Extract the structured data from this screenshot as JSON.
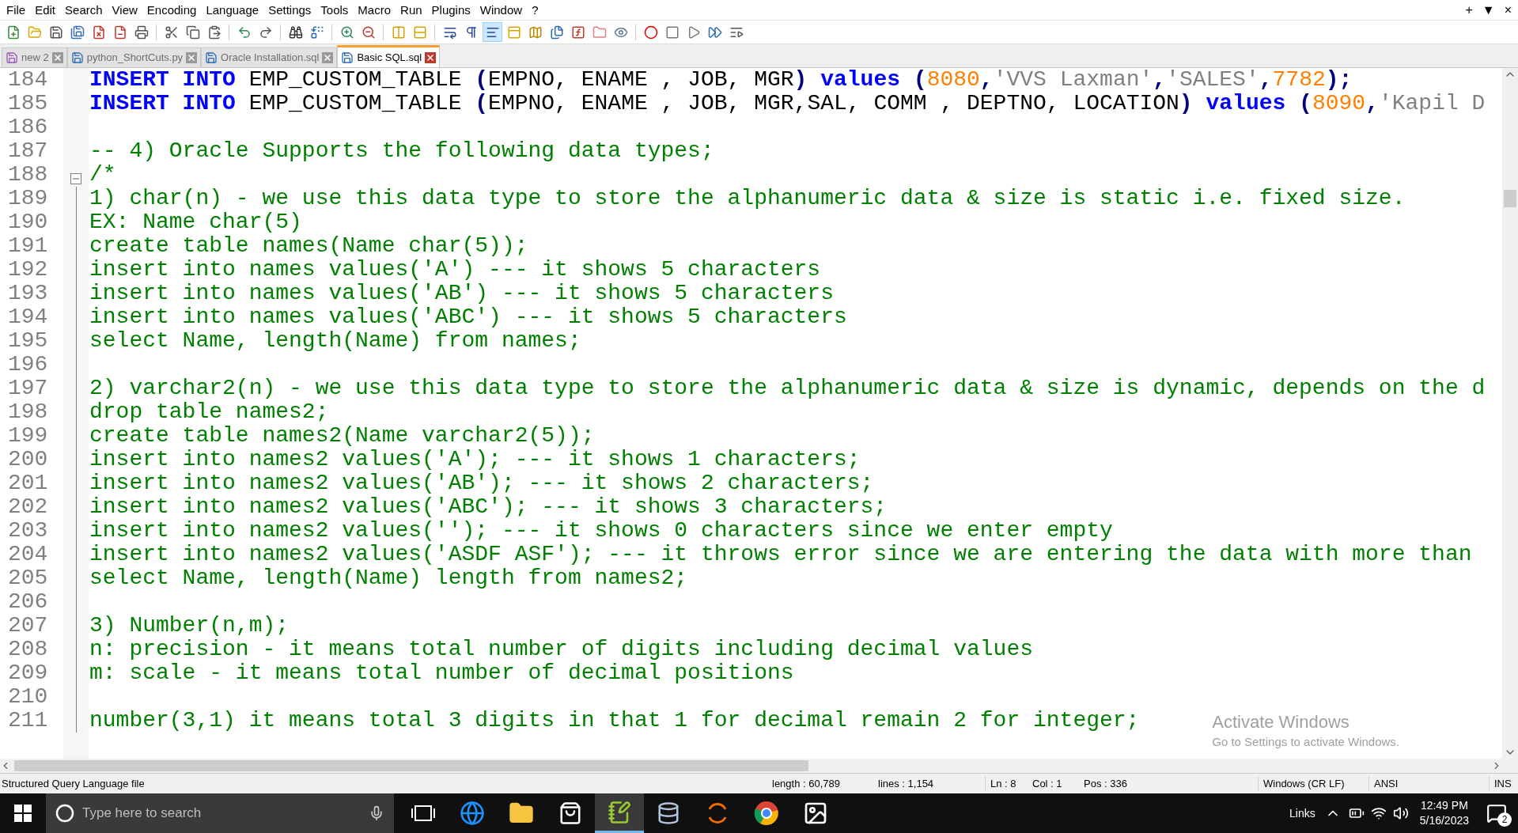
{
  "menu": [
    "File",
    "Edit",
    "Search",
    "View",
    "Encoding",
    "Language",
    "Settings",
    "Tools",
    "Macro",
    "Run",
    "Plugins",
    "Window",
    "?"
  ],
  "window_controls": [
    "+",
    "▼",
    "×"
  ],
  "toolbar_buttons": [
    {
      "pressed": false
    },
    {
      "pressed": false
    },
    {
      "pressed": false
    },
    {
      "pressed": false
    },
    {
      "pressed": false
    },
    {
      "pressed": false
    },
    {
      "pressed": false
    },
    {
      "pressed": false
    },
    {
      "pressed": false
    },
    {
      "pressed": false
    },
    {
      "pressed": false
    },
    {
      "pressed": false
    },
    {
      "pressed": false
    },
    {
      "pressed": false
    },
    {
      "pressed": false
    },
    {
      "pressed": false
    },
    {
      "pressed": false
    },
    {
      "pressed": false
    },
    {
      "pressed": false
    },
    {
      "pressed": false
    },
    {
      "pressed": true
    },
    {
      "pressed": false
    },
    {
      "pressed": false
    },
    {
      "pressed": false
    },
    {
      "pressed": false
    },
    {
      "pressed": false
    },
    {
      "pressed": false
    },
    {
      "pressed": false
    },
    {
      "pressed": false
    },
    {
      "pressed": false
    },
    {
      "pressed": false
    },
    {
      "pressed": false
    }
  ],
  "tabs": [
    {
      "label": "new 2",
      "selected": false,
      "modified": true
    },
    {
      "label": "python_ShortCuts.py",
      "selected": false,
      "modified": false
    },
    {
      "label": "Oracle Installation.sql",
      "selected": false,
      "modified": false
    },
    {
      "label": "Basic SQL.sql",
      "selected": true,
      "modified": false
    }
  ],
  "editor": {
    "lines": [
      {
        "number": "184",
        "segments": [
          {
            "kind": "keyword",
            "text": "INSERT INTO"
          },
          {
            "kind": "plain",
            "text": " EMP_CUSTOM_TABLE "
          },
          {
            "kind": "operator",
            "text": "("
          },
          {
            "kind": "plain",
            "text": "EMPNO, ENAME , JOB, MGR"
          },
          {
            "kind": "operator",
            "text": ") "
          },
          {
            "kind": "keyword",
            "text": "values "
          },
          {
            "kind": "operator",
            "text": "("
          },
          {
            "kind": "number",
            "text": "8080"
          },
          {
            "kind": "operator",
            "text": ","
          },
          {
            "kind": "string",
            "text": "'VVS Laxman'"
          },
          {
            "kind": "operator",
            "text": ","
          },
          {
            "kind": "string",
            "text": "'SALES'"
          },
          {
            "kind": "operator",
            "text": ","
          },
          {
            "kind": "number",
            "text": "7782"
          },
          {
            "kind": "operator",
            "text": ");"
          }
        ]
      },
      {
        "number": "185",
        "segments": [
          {
            "kind": "keyword",
            "text": "INSERT INTO"
          },
          {
            "kind": "plain",
            "text": " EMP_CUSTOM_TABLE "
          },
          {
            "kind": "operator",
            "text": "("
          },
          {
            "kind": "plain",
            "text": "EMPNO, ENAME , JOB, MGR,SAL, COMM , DEPTNO, LOCATION"
          },
          {
            "kind": "operator",
            "text": ") "
          },
          {
            "kind": "keyword",
            "text": "values "
          },
          {
            "kind": "operator",
            "text": "("
          },
          {
            "kind": "number",
            "text": "8090"
          },
          {
            "kind": "operator",
            "text": ","
          },
          {
            "kind": "string",
            "text": "'Kapil D"
          }
        ]
      },
      {
        "number": "186"
      },
      {
        "number": "187",
        "segments": [
          {
            "kind": "comment",
            "text": "-- 4) Oracle Supports the following data types;"
          }
        ]
      },
      {
        "number": "188",
        "fold_marker": true,
        "segments": [
          {
            "kind": "comment",
            "text": "/*"
          }
        ]
      },
      {
        "number": "189",
        "fold_line": true,
        "segments": [
          {
            "kind": "comment",
            "text": "1) char(n) - we use this data type to store the alphanumeric data & size is static i.e. fixed size."
          }
        ]
      },
      {
        "number": "190",
        "fold_line": true,
        "segments": [
          {
            "kind": "comment",
            "text": "EX: Name char(5)"
          }
        ]
      },
      {
        "number": "191",
        "fold_line": true,
        "segments": [
          {
            "kind": "comment",
            "text": "create table names(Name char(5));"
          }
        ]
      },
      {
        "number": "192",
        "fold_line": true,
        "segments": [
          {
            "kind": "comment",
            "text": "insert into names values('A') --- it shows 5 characters"
          }
        ]
      },
      {
        "number": "193",
        "fold_line": true,
        "segments": [
          {
            "kind": "comment",
            "text": "insert into names values('AB') --- it shows 5 characters"
          }
        ]
      },
      {
        "number": "194",
        "fold_line": true,
        "segments": [
          {
            "kind": "comment",
            "text": "insert into names values('ABC') --- it shows 5 characters"
          }
        ]
      },
      {
        "number": "195",
        "fold_line": true,
        "segments": [
          {
            "kind": "comment",
            "text": "select Name, length(Name) from names;"
          }
        ]
      },
      {
        "number": "196",
        "fold_line": true
      },
      {
        "number": "197",
        "fold_line": true,
        "segments": [
          {
            "kind": "comment",
            "text": "2) varchar2(n) - we use this data type to store the alphanumeric data & size is dynamic, depends on the d"
          }
        ]
      },
      {
        "number": "198",
        "fold_line": true,
        "segments": [
          {
            "kind": "comment",
            "text": "drop table names2;"
          }
        ]
      },
      {
        "number": "199",
        "fold_line": true,
        "segments": [
          {
            "kind": "comment",
            "text": "create table names2(Name varchar2(5));"
          }
        ]
      },
      {
        "number": "200",
        "fold_line": true,
        "segments": [
          {
            "kind": "comment",
            "text": "insert into names2 values('A'); --- it shows 1 characters;"
          }
        ]
      },
      {
        "number": "201",
        "fold_line": true,
        "segments": [
          {
            "kind": "comment",
            "text": "insert into names2 values('AB'); --- it shows 2 characters;"
          }
        ]
      },
      {
        "number": "202",
        "fold_line": true,
        "segments": [
          {
            "kind": "comment",
            "text": "insert into names2 values('ABC'); --- it shows 3 characters;"
          }
        ]
      },
      {
        "number": "203",
        "fold_line": true,
        "segments": [
          {
            "kind": "comment",
            "text": "insert into names2 values(''); --- it shows 0 characters since we enter empty"
          }
        ]
      },
      {
        "number": "204",
        "fold_line": true,
        "segments": [
          {
            "kind": "comment",
            "text": "insert into names2 values('ASDF ASF'); --- it throws error since we are entering the data with more than"
          }
        ]
      },
      {
        "number": "205",
        "fold_line": true,
        "segments": [
          {
            "kind": "comment",
            "text": "select Name, length(Name) length from names2;"
          }
        ]
      },
      {
        "number": "206",
        "fold_line": true
      },
      {
        "number": "207",
        "fold_line": true,
        "segments": [
          {
            "kind": "comment",
            "text": "3) Number(n,m);"
          }
        ]
      },
      {
        "number": "208",
        "fold_line": true,
        "segments": [
          {
            "kind": "comment",
            "text": "n: precision - it means total number of digits including decimal values"
          }
        ]
      },
      {
        "number": "209",
        "fold_line": true,
        "segments": [
          {
            "kind": "comment",
            "text": "m: scale - it means total number of decimal positions"
          }
        ]
      },
      {
        "number": "210",
        "fold_line": true
      },
      {
        "number": "211",
        "fold_line": true,
        "segments": [
          {
            "kind": "comment",
            "text": "number(3,1) it means total 3 digits in that 1 for decimal remain 2 for integer;"
          }
        ]
      }
    ]
  },
  "os_notice": {
    "title": "Activate Windows",
    "text": "Go to Settings to activate Windows."
  },
  "status_bar": {
    "file_type": "Structured Query Language file",
    "length": "length : 60,789",
    "lines": "lines : 1,154",
    "ln": "Ln : 8",
    "col": "Col : 1",
    "pos": "Pos : 336",
    "eol": "Windows (CR LF)",
    "encoding": "ANSI",
    "mode": "INS"
  },
  "taskbar": {
    "search": {
      "placeholder": "Type here to search"
    },
    "apps": [
      {
        "active": false
      },
      {
        "active": false
      },
      {
        "active": false
      },
      {
        "active": false
      },
      {
        "active": true
      },
      {
        "active": false
      },
      {
        "active": false
      },
      {
        "active": false
      },
      {
        "active": false
      }
    ],
    "tray_label": "Links",
    "time": "12:49 PM",
    "date": "5/16/2023",
    "notifications": "2"
  }
}
